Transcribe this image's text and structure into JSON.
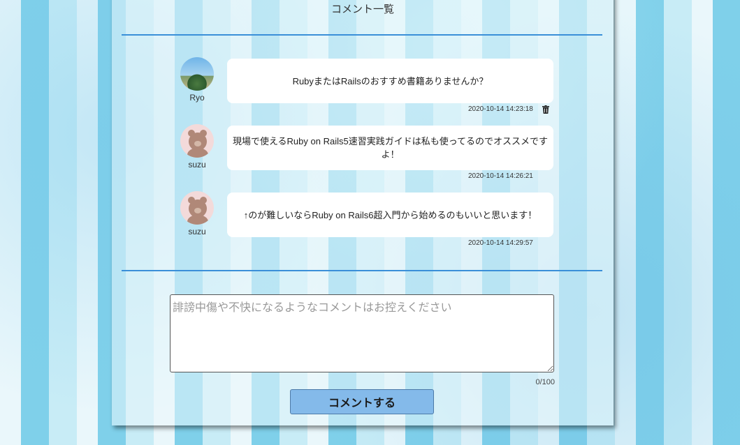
{
  "page": {
    "title": "コメント一覧"
  },
  "comments": [
    {
      "user": "Ryo",
      "avatar_icon": "landscape-photo-avatar",
      "text": "RubyまたはRailsのおすすめ書籍ありませんか？",
      "timestamp": "2020-10-14 14:23:18",
      "deletable": true
    },
    {
      "user": "suzu",
      "avatar_icon": "bear-avatar",
      "text": "現場で使えるRuby on Rails5速習実践ガイドは私も使ってるのでオススメですよ！",
      "timestamp": "2020-10-14 14:26:21",
      "deletable": false
    },
    {
      "user": "suzu",
      "avatar_icon": "bear-avatar",
      "text": "↑のが難しいならRuby on Rails6超入門から始めるのもいいと思います！",
      "timestamp": "2020-10-14 14:29:57",
      "deletable": false
    }
  ],
  "form": {
    "placeholder": "誹謗中傷や不快になるようなコメントはお控えください",
    "value": "",
    "counter": "0/100",
    "submit_label": "コメントする"
  },
  "colors": {
    "divider": "#3a8fd8",
    "button_bg": "#84baea",
    "stripe_dark": "#7fd0ea",
    "stripe_light": "#eaf7fb"
  }
}
